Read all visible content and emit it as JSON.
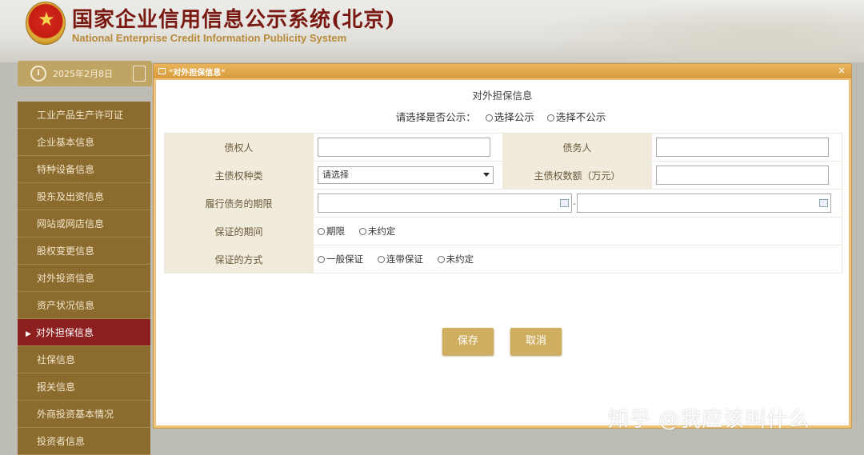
{
  "header": {
    "title_cn": "国家企业信用信息公示系统(北京)",
    "title_en": "National Enterprise Credit Information Publicity System"
  },
  "date": "2025年2月8日",
  "sidebar": {
    "items": [
      {
        "label": "工业产品生产许可证",
        "active": false
      },
      {
        "label": "企业基本信息",
        "active": false
      },
      {
        "label": "特种设备信息",
        "active": false
      },
      {
        "label": "股东及出资信息",
        "active": false
      },
      {
        "label": "网站或网店信息",
        "active": false
      },
      {
        "label": "股权变更信息",
        "active": false
      },
      {
        "label": "对外投资信息",
        "active": false
      },
      {
        "label": "资产状况信息",
        "active": false
      },
      {
        "label": "对外担保信息",
        "active": true
      },
      {
        "label": "社保信息",
        "active": false
      },
      {
        "label": "报关信息",
        "active": false
      },
      {
        "label": "外商投资基本情况",
        "active": false
      },
      {
        "label": "投资者信息",
        "active": false
      }
    ]
  },
  "dialog": {
    "title": "\"对外担保信息\"",
    "close": "×",
    "heading": "对外担保信息",
    "publicity_prompt": "请选择是否公示：",
    "publicity_options": [
      "选择公示",
      "选择不公示"
    ],
    "form": {
      "creditor_label": "债权人",
      "creditor_value": "",
      "debtor_label": "债务人",
      "debtor_value": "",
      "claim_type_label": "主债权种类",
      "claim_type_selected": "请选择",
      "claim_amount_label": "主债权数额（万元）",
      "claim_amount_value": "",
      "term_label": "履行债务的期限",
      "term_separator": "-",
      "guarantee_period_label": "保证的期间",
      "guarantee_period_options": [
        "期限",
        "未约定"
      ],
      "guarantee_method_label": "保证的方式",
      "guarantee_method_options": [
        "一般保证",
        "连带保证",
        "未约定"
      ]
    },
    "save_label": "保存",
    "cancel_label": "取消"
  },
  "watermark": "知乎 @我应该叫什么",
  "colors": {
    "sidebar_bg": "#8c6b2e",
    "sidebar_active": "#8d1f1f",
    "button_bg": "#cfae5f",
    "dialog_frame": "#efc47a"
  }
}
